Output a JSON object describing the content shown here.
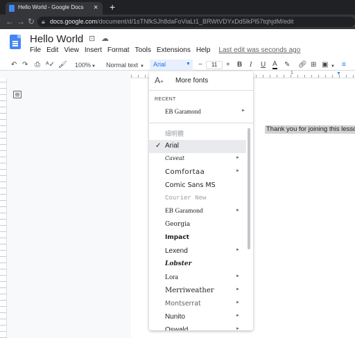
{
  "browser": {
    "tab_title": "Hello World - Google Docs",
    "url_host": "docs.google.com",
    "url_path": "/document/d/1sTNfkSJh8daFoViaLt1_BRWtVDYxDd5lkPl57tqhjdM/edit"
  },
  "doc": {
    "title": "Hello World",
    "menu": [
      "File",
      "Edit",
      "View",
      "Insert",
      "Format",
      "Tools",
      "Extensions",
      "Help"
    ],
    "last_edit": "Last edit was seconds ago",
    "body_text": "Thank you for joining this lesson."
  },
  "toolbar": {
    "zoom": "100%",
    "style": "Normal text",
    "font": "Arial",
    "minus": "−",
    "size": "11",
    "plus": "+",
    "bold": "B",
    "italic": "I",
    "underline": "U",
    "text_color": "A",
    "ruler_number": "1"
  },
  "font_menu": {
    "more_fonts": "More fonts",
    "recent_label": "RECENT",
    "recent": [
      {
        "name": "EB Garamond",
        "submenu": true
      }
    ],
    "fonts": [
      {
        "name": "細明體",
        "submenu": false,
        "selected": false
      },
      {
        "name": "Arial",
        "submenu": false,
        "selected": true
      },
      {
        "name": "Caveat",
        "submenu": true,
        "selected": false
      },
      {
        "name": "Comfortaa",
        "submenu": true,
        "selected": false
      },
      {
        "name": "Comic Sans MS",
        "submenu": false,
        "selected": false
      },
      {
        "name": "Courier New",
        "submenu": false,
        "selected": false
      },
      {
        "name": "EB Garamond",
        "submenu": true,
        "selected": false
      },
      {
        "name": "Georgia",
        "submenu": false,
        "selected": false
      },
      {
        "name": "Impact",
        "submenu": false,
        "selected": false
      },
      {
        "name": "Lexend",
        "submenu": true,
        "selected": false
      },
      {
        "name": "Lobster",
        "submenu": false,
        "selected": false
      },
      {
        "name": "Lora",
        "submenu": true,
        "selected": false
      },
      {
        "name": "Merriweather",
        "submenu": true,
        "selected": false
      },
      {
        "name": "Montserrat",
        "submenu": true,
        "selected": false
      },
      {
        "name": "Nunito",
        "submenu": true,
        "selected": false
      },
      {
        "name": "Oswald",
        "submenu": true,
        "selected": false
      }
    ]
  },
  "colors": {
    "accent": "#1a73e8",
    "docs_blue": "#4285f4",
    "chrome_dark": "#202124"
  }
}
